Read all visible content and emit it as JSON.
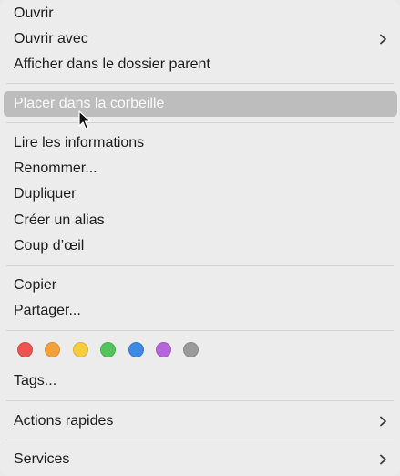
{
  "menu": {
    "items": [
      {
        "label": "Ouvrir"
      },
      {
        "label": "Ouvrir avec",
        "submenu": true
      },
      {
        "label": "Afficher dans le dossier parent"
      },
      {
        "label": "Placer dans la corbeille",
        "highlighted": true
      },
      {
        "label": "Lire les informations"
      },
      {
        "label": "Renommer..."
      },
      {
        "label": "Dupliquer"
      },
      {
        "label": "Créer un alias"
      },
      {
        "label": "Coup d’œil"
      },
      {
        "label": "Copier"
      },
      {
        "label": "Partager..."
      },
      {
        "label": "Tags..."
      },
      {
        "label": "Actions rapides",
        "submenu": true
      },
      {
        "label": "Services",
        "submenu": true
      }
    ],
    "tag_colors": [
      {
        "name": "red",
        "color": "#ef5350"
      },
      {
        "name": "orange",
        "color": "#f4a13a"
      },
      {
        "name": "yellow",
        "color": "#f5cd3e"
      },
      {
        "name": "green",
        "color": "#52c45b"
      },
      {
        "name": "blue",
        "color": "#3b8ae6"
      },
      {
        "name": "purple",
        "color": "#b566d8"
      },
      {
        "name": "gray",
        "color": "#9a9a9a"
      }
    ],
    "highlight_color": "#bdbdbd",
    "background_color": "#ececec"
  }
}
